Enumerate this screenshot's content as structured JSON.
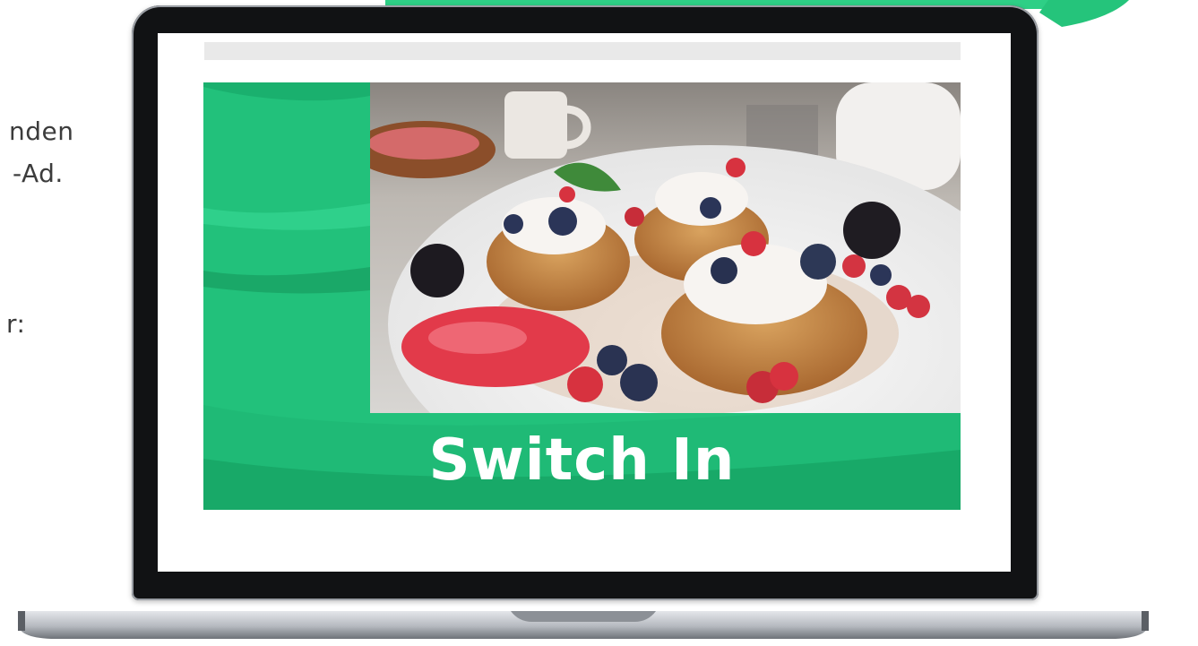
{
  "side_text": {
    "line1": "nden",
    "line2": "-Ad.",
    "line3": "r:"
  },
  "ad": {
    "headline": "Switch In",
    "image_description_icon": "food-photo-icon"
  },
  "colors": {
    "brand_green": "#22c17b",
    "dark_green": "#17a868",
    "laptop_bezel": "#111214",
    "loading_bar": "#e9e9e9"
  }
}
